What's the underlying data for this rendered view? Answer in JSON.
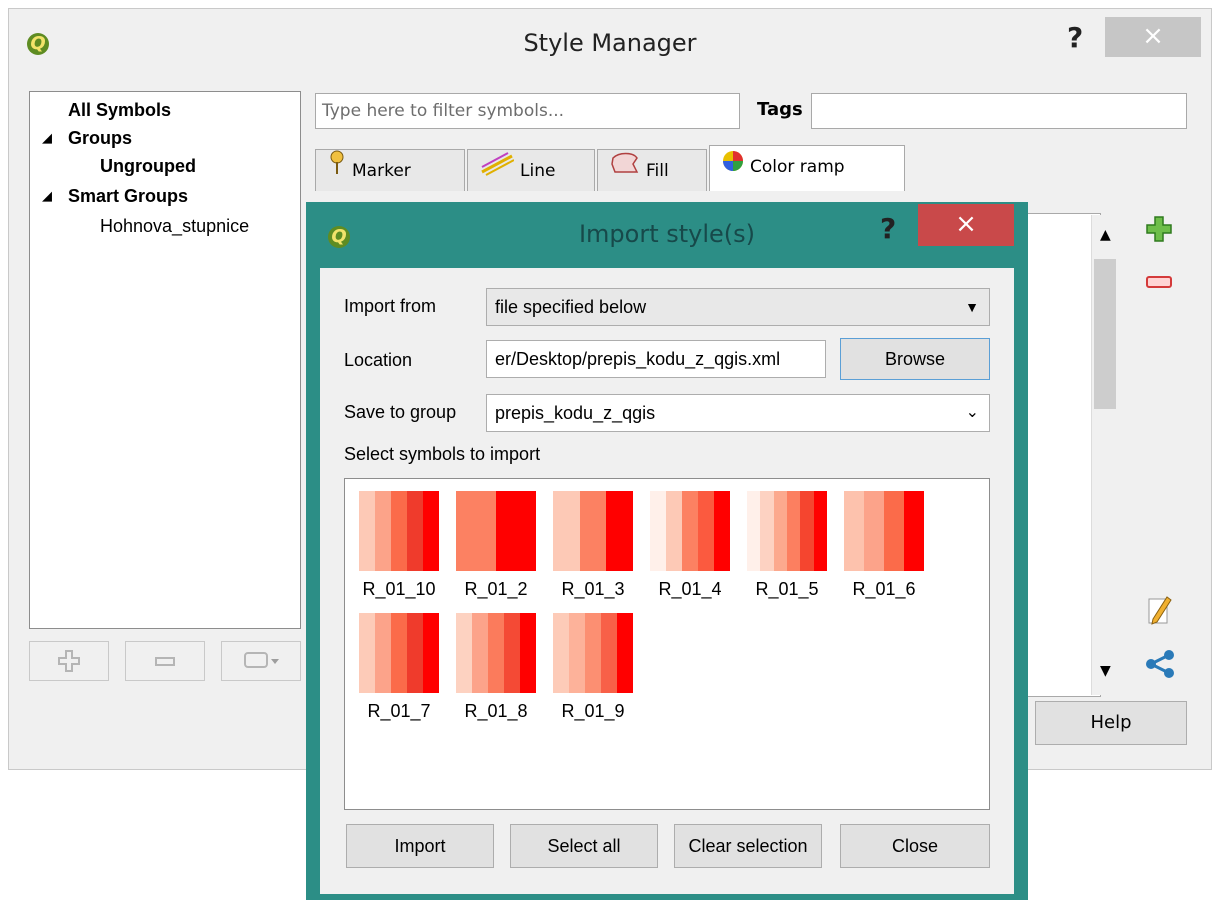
{
  "style_manager": {
    "title": "Style Manager",
    "help": "?",
    "close": "×",
    "tree": [
      {
        "label": "All Symbols",
        "bold": true
      },
      {
        "label": "Groups",
        "bold": true,
        "arrow": "◢"
      },
      {
        "label": "Ungrouped",
        "bold": true
      },
      {
        "label": "Smart Groups",
        "bold": true,
        "arrow": "◢"
      },
      {
        "label": "Hohnova_stupnice",
        "bold": false
      }
    ],
    "filter_placeholder": "Type here to filter symbols...",
    "tags_label": "Tags",
    "tabs": [
      {
        "label": "Marker",
        "icon": "marker-icon"
      },
      {
        "label": "Line",
        "icon": "line-icon"
      },
      {
        "label": "Fill",
        "icon": "fill-icon"
      },
      {
        "label": "Color ramp",
        "icon": "color-ramp-icon"
      }
    ],
    "help_button": "Help"
  },
  "import_dialog": {
    "title": "Import style(s)",
    "help": "?",
    "close": "×",
    "import_from_label": "Import from",
    "import_from_value": "file specified below",
    "location_label": "Location",
    "location_value": "er/Desktop/prepis_kodu_z_qgis.xml",
    "browse_label": "Browse",
    "save_to_group_label": "Save to group",
    "save_to_group_value": "prepis_kodu_z_qgis",
    "select_symbols_label": "Select symbols to import",
    "symbols": [
      {
        "name": "R_01_10",
        "colors": [
          "#fdc9b6",
          "#fca389",
          "#fb6b4a",
          "#ef3b2c",
          "#ff0000"
        ]
      },
      {
        "name": "R_01_2",
        "colors": [
          "#fc8162",
          "#ff0000"
        ]
      },
      {
        "name": "R_01_3",
        "colors": [
          "#fdc9b6",
          "#fc8162",
          "#ff0000"
        ]
      },
      {
        "name": "R_01_4",
        "colors": [
          "#fff0ea",
          "#fdc9b6",
          "#fc8162",
          "#fb5a3f",
          "#ff0000"
        ]
      },
      {
        "name": "R_01_5",
        "colors": [
          "#fff0ea",
          "#fdd2c2",
          "#fca98e",
          "#fc7f60",
          "#f5452f",
          "#ff0000"
        ]
      },
      {
        "name": "R_01_6",
        "colors": [
          "#fdc2ad",
          "#fca38a",
          "#fb6b4a",
          "#ff0000"
        ]
      },
      {
        "name": "R_01_7",
        "colors": [
          "#fdcbb8",
          "#fca38a",
          "#fb6b4a",
          "#ef3b2c",
          "#ff0000"
        ]
      },
      {
        "name": "R_01_8",
        "colors": [
          "#fdd2c1",
          "#fca38a",
          "#fb7b5c",
          "#f44a35",
          "#ff0000"
        ]
      },
      {
        "name": "R_01_9",
        "colors": [
          "#fdcbb8",
          "#fdb29a",
          "#fc8f72",
          "#f86048",
          "#ff0000"
        ]
      }
    ],
    "buttons": {
      "import": "Import",
      "select_all": "Select all",
      "clear_selection": "Clear selection",
      "close": "Close"
    }
  }
}
